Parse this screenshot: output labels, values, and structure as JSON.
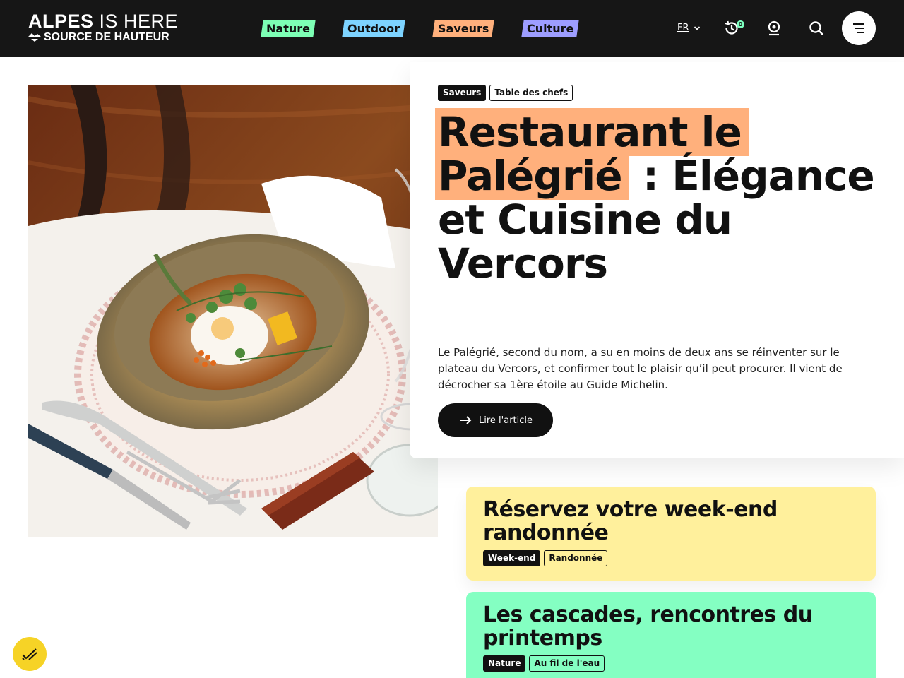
{
  "header": {
    "logo_line1_bold": "ALPES",
    "logo_line1_rest": " IS HERE",
    "logo_line2": "SOURCE DE HAUTEUR",
    "nav": [
      {
        "label": "Nature",
        "color": "#7dffb5"
      },
      {
        "label": "Outdoor",
        "color": "#7dd3ff"
      },
      {
        "label": "Saveurs",
        "color": "#ffb07c"
      },
      {
        "label": "Culture",
        "color": "#9d9dff"
      }
    ],
    "language": "FR",
    "history_count": "0",
    "icons": [
      "history-icon",
      "location-icon",
      "search-icon",
      "menu-icon"
    ]
  },
  "hero": {
    "tags": [
      "Saveurs",
      "Table des chefs"
    ],
    "title_highlight": "Restaurant le Palégrié",
    "title_rest": " : Élégance et Cuisine du Vercors",
    "description": "Le Palégrié, second du nom, a su en moins de deux ans se réinventer sur le plateau du Vercors, et confirmer tout le plaisir qu’il peut procurer. Il vient de décrocher sa 1ère étoile au Guide Michelin.",
    "cta_label": "Lire l'article",
    "highlight_color": "#ffb07c"
  },
  "cards": [
    {
      "title": "Réservez votre week-end randonnée",
      "tags": [
        "Week-end",
        "Randonnée"
      ],
      "color": "#fff09c"
    },
    {
      "title": "Les cascades, rencontres du printemps",
      "tags": [
        "Nature",
        "Au fil de l'eau"
      ],
      "color": "#84ffc2"
    }
  ],
  "colors": {
    "header_bg": "#161616",
    "accessibility_button": "#f6d326"
  }
}
